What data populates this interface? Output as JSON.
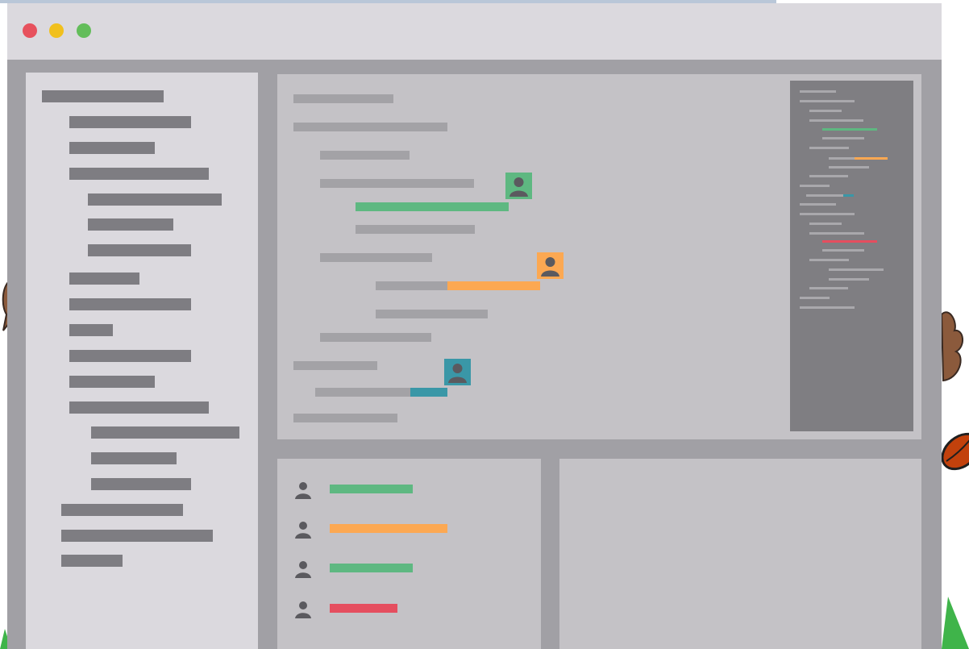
{
  "window": {
    "controls": [
      {
        "name": "close-button",
        "color": "#e7515d"
      },
      {
        "name": "minimize-button",
        "color": "#f1c01d"
      },
      {
        "name": "maximize-button",
        "color": "#63bd5a"
      }
    ]
  },
  "colors": {
    "green": "#5eb881",
    "orange": "#fca852",
    "teal": "#3a97a7",
    "red": "#e54e5f"
  },
  "sidebar": {
    "items": [
      {
        "indent": 0,
        "level": "root"
      },
      {
        "indent": 1
      },
      {
        "indent": 1
      },
      {
        "indent": 1
      },
      {
        "indent": 2
      },
      {
        "indent": 2
      },
      {
        "indent": 2
      },
      {
        "indent": 1
      },
      {
        "indent": 1
      },
      {
        "indent": 1
      },
      {
        "indent": 1
      },
      {
        "indent": 1
      },
      {
        "indent": 1
      },
      {
        "indent": 2
      },
      {
        "indent": 2
      },
      {
        "indent": 2
      },
      {
        "indent": 0
      },
      {
        "indent": 0
      },
      {
        "indent": 0
      }
    ]
  },
  "editor": {
    "collaborators": [
      {
        "color": "orange-green",
        "icon": "user-icon",
        "accent": "green"
      },
      {
        "color": "orange",
        "icon": "user-icon",
        "accent": "orange"
      },
      {
        "color": "teal",
        "icon": "user-icon",
        "accent": "teal"
      }
    ]
  },
  "team_panel": {
    "members": [
      {
        "icon": "user-icon",
        "accent": "green"
      },
      {
        "icon": "user-icon",
        "accent": "orange"
      },
      {
        "icon": "user-icon",
        "accent": "green"
      },
      {
        "icon": "user-icon",
        "accent": "red"
      }
    ]
  }
}
